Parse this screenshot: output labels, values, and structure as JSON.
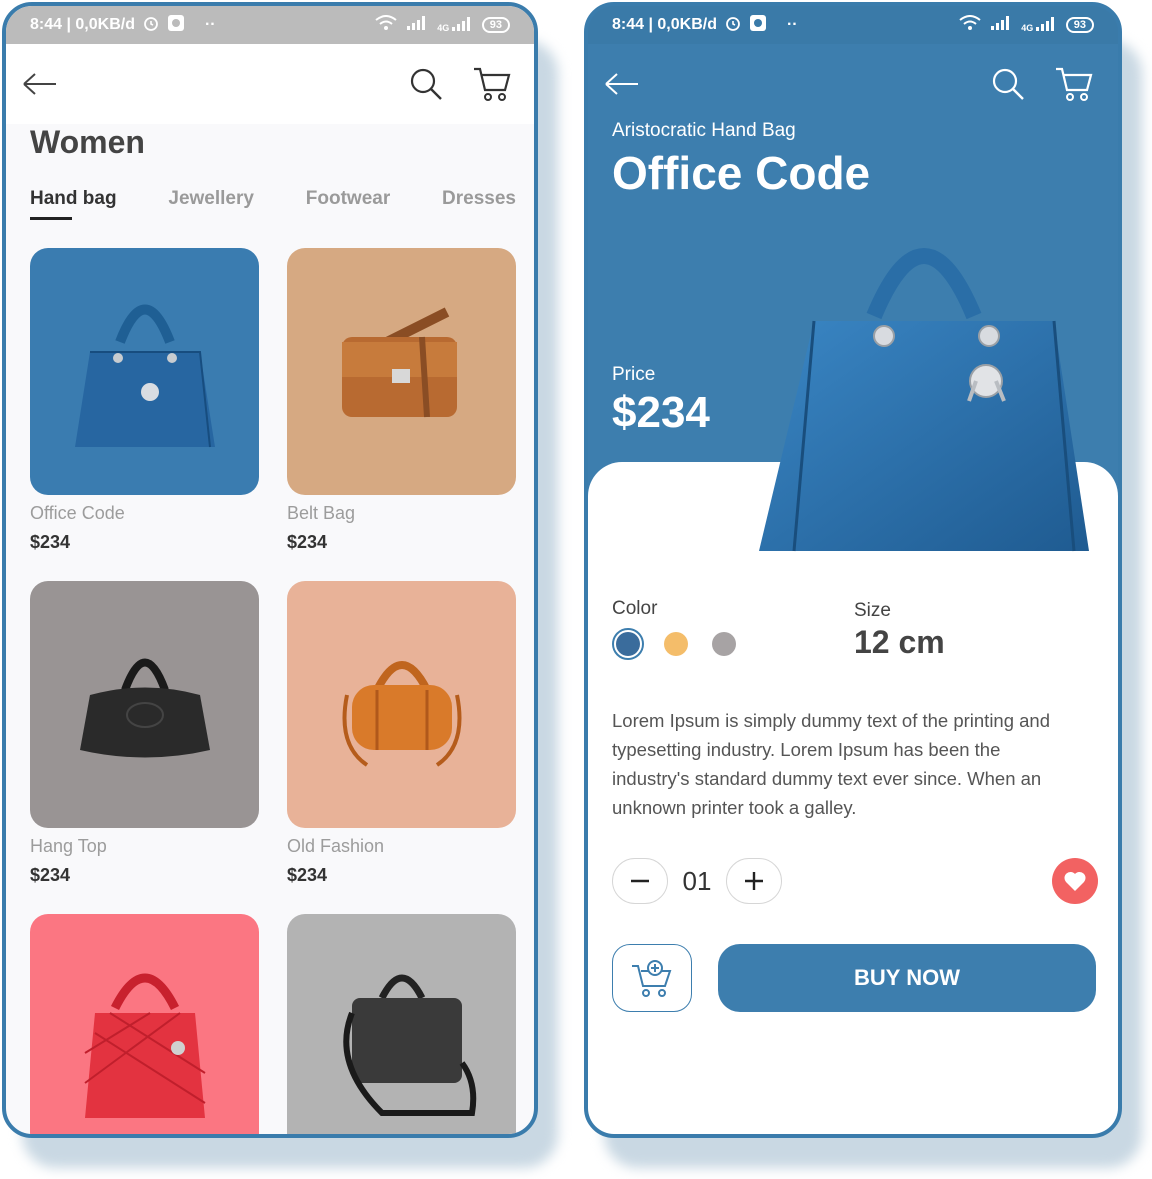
{
  "status_bar": {
    "time_info": "8:44 | 0,0KB/d",
    "dots": "··",
    "network": "4G",
    "battery": "93"
  },
  "list_screen": {
    "title": "Women",
    "tabs": [
      {
        "label": "Hand bag",
        "active": true
      },
      {
        "label": "Jewellery",
        "active": false
      },
      {
        "label": "Footwear",
        "active": false
      },
      {
        "label": "Dresses",
        "active": false
      }
    ],
    "products": [
      {
        "name": "Office Code",
        "price": "$234",
        "bg": "#3a7cb0"
      },
      {
        "name": "Belt Bag",
        "price": "$234",
        "bg": "#d6a982"
      },
      {
        "name": "Hang Top",
        "price": "$234",
        "bg": "#999494"
      },
      {
        "name": "Old Fashion",
        "price": "$234",
        "bg": "#e8b298"
      },
      {
        "name": "",
        "price": "",
        "bg": "#fb7682"
      },
      {
        "name": "",
        "price": "",
        "bg": "#b3b3b3"
      }
    ]
  },
  "detail_screen": {
    "subtitle": "Aristocratic Hand Bag",
    "title": "Office Code",
    "price_label": "Price",
    "price": "$234",
    "color_label": "Color",
    "colors": [
      "#3a6c9c",
      "#f4bd6a",
      "#a7a3a4"
    ],
    "selected_color": 0,
    "size_label": "Size",
    "size_value": "12 cm",
    "description": "Lorem Ipsum is simply dummy text of the printing and typesetting industry. Lorem Ipsum has been the industry's standard dummy text ever since. When an unknown printer took a galley.",
    "quantity": "01",
    "buy_label": "BUY NOW"
  },
  "icons": {
    "back": "arrow-left-icon",
    "search": "search-icon",
    "cart": "cart-icon",
    "heart": "heart-icon",
    "add_to_cart": "cart-plus-icon"
  },
  "colors": {
    "accent": "#3d7eae",
    "favorite": "#f26262"
  }
}
